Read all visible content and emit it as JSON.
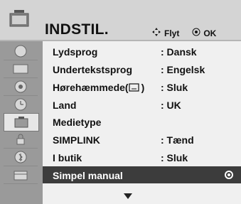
{
  "header": {
    "title": "INDSTIL.",
    "nav_move_label": "Flyt",
    "nav_ok_label": "OK"
  },
  "menu": {
    "rows": [
      {
        "label": "Lydsprog",
        "value": ": Dansk"
      },
      {
        "label": "Undertekstsprog",
        "value": ": Engelsk"
      },
      {
        "label": "Hørehæmmede(",
        "value": ": Sluk"
      },
      {
        "label": "Land",
        "value": ": UK"
      },
      {
        "label": "Medietype",
        "value": ""
      },
      {
        "label": "SIMPLINK",
        "value": ": Tænd"
      },
      {
        "label": "I butik",
        "value": ": Sluk"
      },
      {
        "label": "Simpel manual",
        "value": ""
      }
    ],
    "selected_index": 7
  },
  "sidebar": {
    "icons": [
      "satellite-dish-icon",
      "picture-icon",
      "audio-icon",
      "clock-icon",
      "settings-icon",
      "lock-icon",
      "bluetooth-icon",
      "media-icon"
    ],
    "active_index": 4
  },
  "colors": {
    "selected_row": "#3c3c3c",
    "rail": "#9a9a9a"
  }
}
